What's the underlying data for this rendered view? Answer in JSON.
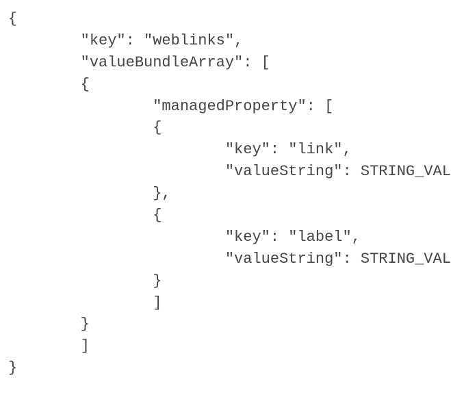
{
  "lines": [
    {
      "indent": 0,
      "text": "{"
    },
    {
      "indent": 2,
      "text": "\"key\": \"weblinks\","
    },
    {
      "indent": 2,
      "text": "\"valueBundleArray\": ["
    },
    {
      "indent": 2,
      "text": "{"
    },
    {
      "indent": 4,
      "text": "\"managedProperty\": ["
    },
    {
      "indent": 4,
      "text": "{"
    },
    {
      "indent": 6,
      "text": "\"key\": \"link\","
    },
    {
      "indent": 6,
      "text": "\"valueString\": STRING_VALUE"
    },
    {
      "indent": 4,
      "text": "},"
    },
    {
      "indent": 4,
      "text": "{"
    },
    {
      "indent": 6,
      "text": "\"key\": \"label\","
    },
    {
      "indent": 6,
      "text": "\"valueString\": STRING_VALUE"
    },
    {
      "indent": 4,
      "text": "}"
    },
    {
      "indent": 4,
      "text": "]"
    },
    {
      "indent": 2,
      "text": "}"
    },
    {
      "indent": 2,
      "text": "]"
    },
    {
      "indent": 0,
      "text": "}"
    }
  ],
  "indentUnit": "    "
}
